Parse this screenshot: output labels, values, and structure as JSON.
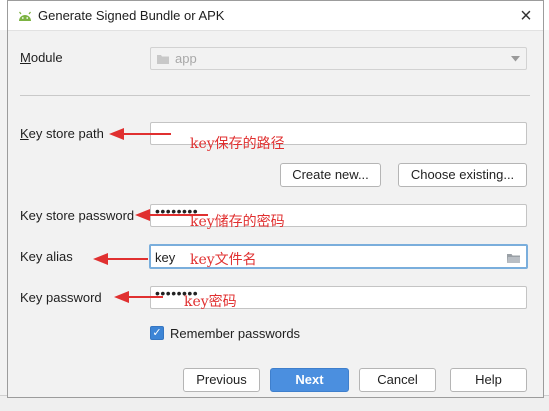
{
  "dialog": {
    "title": "Generate Signed Bundle or APK",
    "close_glyph": "×"
  },
  "module": {
    "label": "Module",
    "value": "app"
  },
  "key_store_path": {
    "label": "Key store path",
    "value": ""
  },
  "buttons": {
    "create_new": "Create new...",
    "choose_existing": "Choose existing...",
    "previous": "Previous",
    "next": "Next",
    "cancel": "Cancel",
    "help": "Help"
  },
  "key_store_password": {
    "label": "Key store password",
    "value": "••••••••"
  },
  "key_alias": {
    "label": "Key alias",
    "value": "key"
  },
  "key_password": {
    "label": "Key password",
    "value": "••••••••"
  },
  "remember": {
    "label": "Remember passwords",
    "checked": true
  },
  "annotations": {
    "path": "key保存的路径",
    "store_password": "key储存的密码",
    "alias": "key文件名",
    "key_password": "key密码"
  },
  "colors": {
    "accent": "#4b8fdf",
    "annotation": "#e03030",
    "android_green": "#7cb342"
  },
  "icons": [
    "android-icon",
    "close-icon",
    "folder-icon",
    "dropdown-arrow-icon",
    "checkmark-icon"
  ]
}
